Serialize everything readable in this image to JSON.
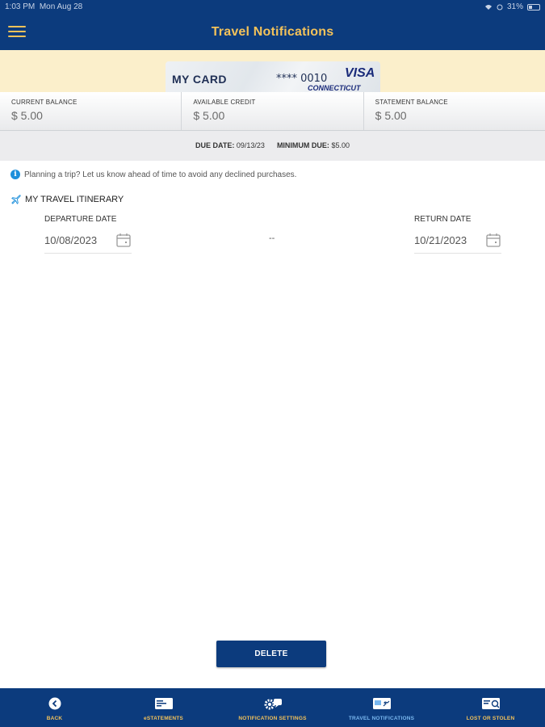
{
  "status_bar": {
    "time": "1:03 PM",
    "date": "Mon Aug 28",
    "battery": "31%"
  },
  "header": {
    "title": "Travel Notifications",
    "menu_icon": "hamburger-menu-icon"
  },
  "card": {
    "name": "MY CARD",
    "number": "**** 0010",
    "brand": "VISA",
    "brand_sub": "CONNECTICUT"
  },
  "balances": [
    {
      "label": "CURRENT BALANCE",
      "value": "$ 5.00"
    },
    {
      "label": "AVAILABLE CREDIT",
      "value": "$ 5.00"
    },
    {
      "label": "STATEMENT BALANCE",
      "value": "$ 5.00"
    }
  ],
  "due": {
    "due_label": "DUE DATE:",
    "due_value": "09/13/23",
    "min_label": "MINIMUM DUE:",
    "min_value": "$5.00"
  },
  "info_text": "Planning a trip? Let us know ahead of time to avoid any declined purchases.",
  "itinerary": {
    "title": "MY TRAVEL ITINERARY",
    "departure_label": "DEPARTURE DATE",
    "departure_value": "10/08/2023",
    "separator": "--",
    "return_label": "RETURN DATE",
    "return_value": "10/21/2023"
  },
  "delete_label": "DELETE",
  "bottom_nav": [
    {
      "label": "BACK",
      "icon": "back-arrow-icon"
    },
    {
      "label": "eSTATEMENTS",
      "icon": "statement-icon"
    },
    {
      "label": "NOTIFICATION SETTINGS",
      "icon": "gear-chat-icon"
    },
    {
      "label": "TRAVEL NOTIFICATIONS",
      "icon": "travel-card-icon",
      "active": true
    },
    {
      "label": "LOST OR STOLEN",
      "icon": "lost-card-icon"
    }
  ],
  "colors": {
    "primary": "#0c3b7d",
    "accent": "#f3c25a",
    "active_nav": "#7ab8f0",
    "banner": "#fbefcb",
    "info": "#1d8fdb"
  }
}
